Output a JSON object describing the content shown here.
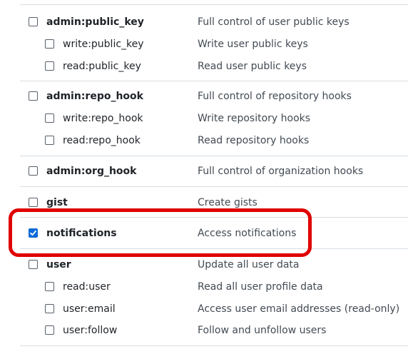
{
  "scopes": {
    "admin_public_key": {
      "label": "admin:public_key",
      "desc": "Full control of user public keys",
      "checked": false,
      "children": [
        {
          "label": "write:public_key",
          "desc": "Write user public keys"
        },
        {
          "label": "read:public_key",
          "desc": "Read user public keys"
        }
      ]
    },
    "admin_repo_hook": {
      "label": "admin:repo_hook",
      "desc": "Full control of repository hooks",
      "checked": false,
      "children": [
        {
          "label": "write:repo_hook",
          "desc": "Write repository hooks"
        },
        {
          "label": "read:repo_hook",
          "desc": "Read repository hooks"
        }
      ]
    },
    "admin_org_hook": {
      "label": "admin:org_hook",
      "desc": "Full control of organization hooks",
      "checked": false
    },
    "gist": {
      "label": "gist",
      "desc": "Create gists",
      "checked": false
    },
    "notifications": {
      "label": "notifications",
      "desc": "Access notifications",
      "checked": true
    },
    "user": {
      "label": "user",
      "desc": "Update all user data",
      "checked": false,
      "children": [
        {
          "label": "read:user",
          "desc": "Read all user profile data"
        },
        {
          "label": "user:email",
          "desc": "Access user email addresses (read-only)"
        },
        {
          "label": "user:follow",
          "desc": "Follow and unfollow users"
        }
      ]
    }
  },
  "colors": {
    "accent": "#0969da",
    "highlight": "#e00000",
    "border": "#d8dee4"
  },
  "icons": {
    "check": "checkmark-icon"
  }
}
